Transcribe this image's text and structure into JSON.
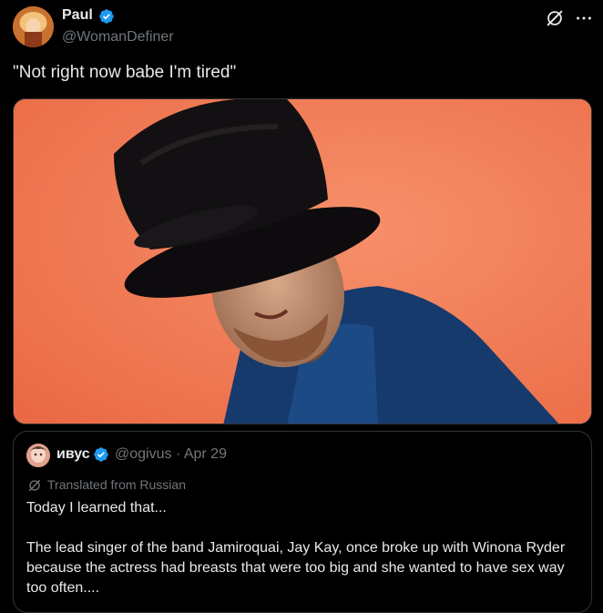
{
  "post": {
    "author": {
      "name": "Paul",
      "handle": "@WomanDefiner",
      "verified": true
    },
    "text": "\"Not right now babe I'm tired\"",
    "media": {
      "kind": "photo",
      "background_color": "#f27a55"
    },
    "actions": {
      "grok_icon": "grok-icon",
      "more_icon": "more-icon"
    }
  },
  "quote": {
    "author": {
      "name": "ивус",
      "handle": "@ogivus",
      "verified": true
    },
    "meta": "@ogivus · Apr 29",
    "translated_label": "Translated from Russian",
    "paragraphs": [
      "Today I learned that...",
      "The lead singer of the band Jamiroquai, Jay Kay, once broke up with Winona Ryder because the actress had breasts that were too big and she wanted to have sex way too often...."
    ]
  },
  "colors": {
    "background": "#000000",
    "text_primary": "#e7e9ea",
    "text_secondary": "#71767b",
    "border": "#2f3336",
    "verified": "#1d9bf0"
  }
}
